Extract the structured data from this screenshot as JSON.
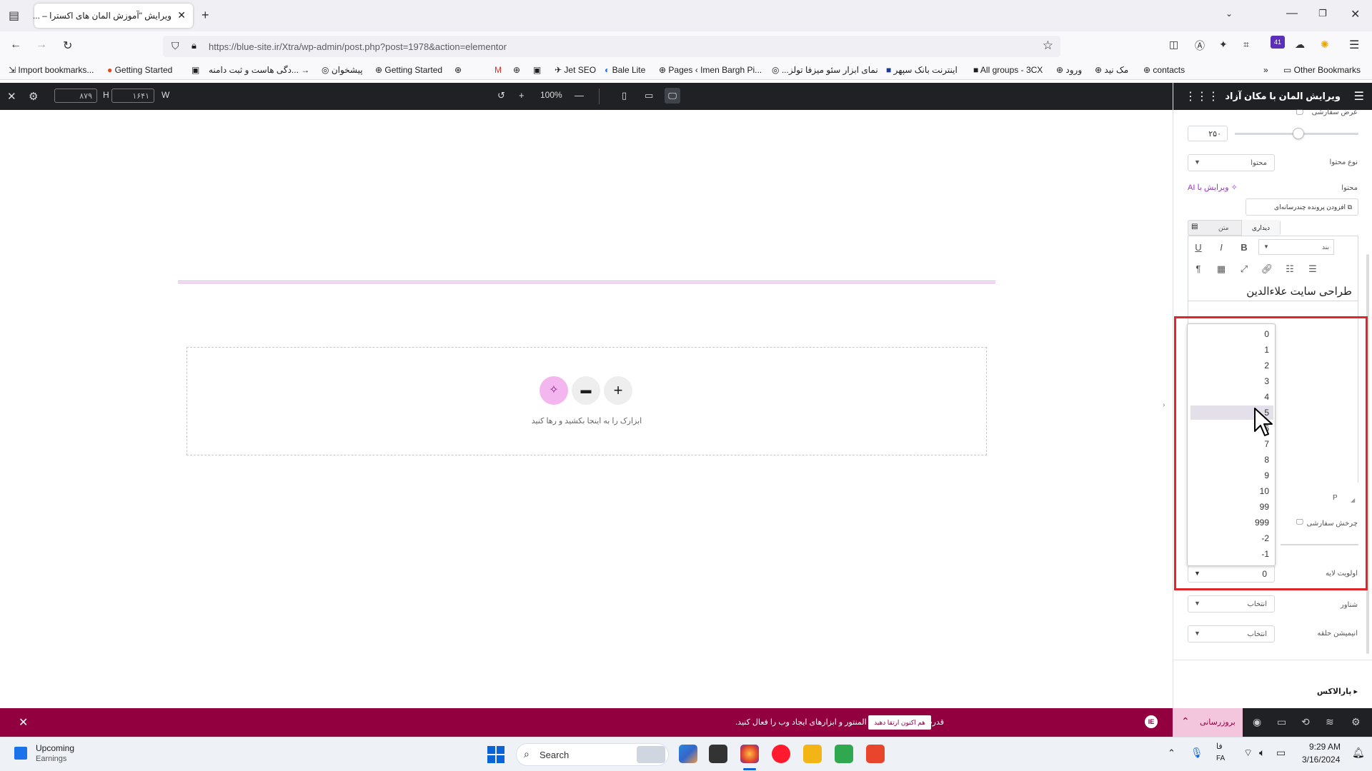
{
  "browser": {
    "tab_title": "ویرایش \"آموزش المان های اکسترا – ...",
    "url": "https://blue-site.ir/Xtra/wp-admin/post.php?post=1978&action=elementor",
    "extensions_badge": "41",
    "bookmarks": [
      "Import bookmarks...",
      "Getting Started",
      "...دگی هاست و ثبت دامنه",
      "پیشخوان",
      "Getting Started",
      "Jet SEO",
      "Bale Lite",
      "Pages ‹ Imen Bargh Pi...",
      "...نمای ابزار سئو میزفا تولز",
      "اینترنت بانک سپهر",
      "All groups - 3CX",
      "ورود",
      "مک نید",
      "contacts",
      "Other Bookmarks"
    ]
  },
  "editor_topbar": {
    "height_value": "۸۷۹",
    "height_label": "H",
    "width_value": "۱۶۴۱",
    "width_label": "W",
    "zoom": "100%"
  },
  "canvas": {
    "curved_text": "طراحی سایت علاءالدین",
    "dropzone_hint": "ابزارک را به اینجا بکشید و رها کنید"
  },
  "panel": {
    "title": "ویرایش المان با مکان آزاد",
    "custom_width_label": "عرض سفارشی",
    "width_number": "۲۵۰",
    "content_type_label": "نوع محتوا",
    "content_type_value": "محتوا",
    "content_label": "محتوا",
    "ai_edit": "ویرایش با AI",
    "add_media": "افزودن پرونده چندرسانه‌ای",
    "tab_visual": "دیداری",
    "tab_text": "متن",
    "paragraph_select": "بند",
    "editor_text": "طراحی سایت علاءالدین",
    "editor_status": "P",
    "custom_rotation_label": "چرخش سفارشی",
    "layer_priority_label": "اولویت لایه",
    "layer_priority_value": "0",
    "layer_options": [
      "0",
      "1",
      "2",
      "3",
      "4",
      "5",
      "6",
      "7",
      "8",
      "9",
      "10",
      "99",
      "999",
      "-2",
      "-1"
    ],
    "highlighted_option": "5",
    "float_label": "شناور",
    "float_value": "انتخاب",
    "loop_anim_label": "انیمیشن حلقه",
    "loop_anim_value": "انتخاب",
    "parallax_label": "پارالاکس"
  },
  "notice": {
    "message": "قدرت کامل ویژگی های المنتور و ابزارهای ایجاد وب را فعال کنید.",
    "upgrade_button": "هم اکنون ارتقا دهید",
    "publish_label": "بروزرسانی"
  },
  "taskbar": {
    "widget_title": "Upcoming",
    "widget_subtitle": "Earnings",
    "search_placeholder": "Search",
    "lang_top": "فا",
    "lang_bottom": "FA",
    "time": "9:29 AM",
    "date": "3/16/2024"
  },
  "colors": {
    "elementor_dark": "#1f2124",
    "notice_bg": "#93003f",
    "highlight_box": "#e0262d",
    "ai_purple": "#a02fd0"
  }
}
